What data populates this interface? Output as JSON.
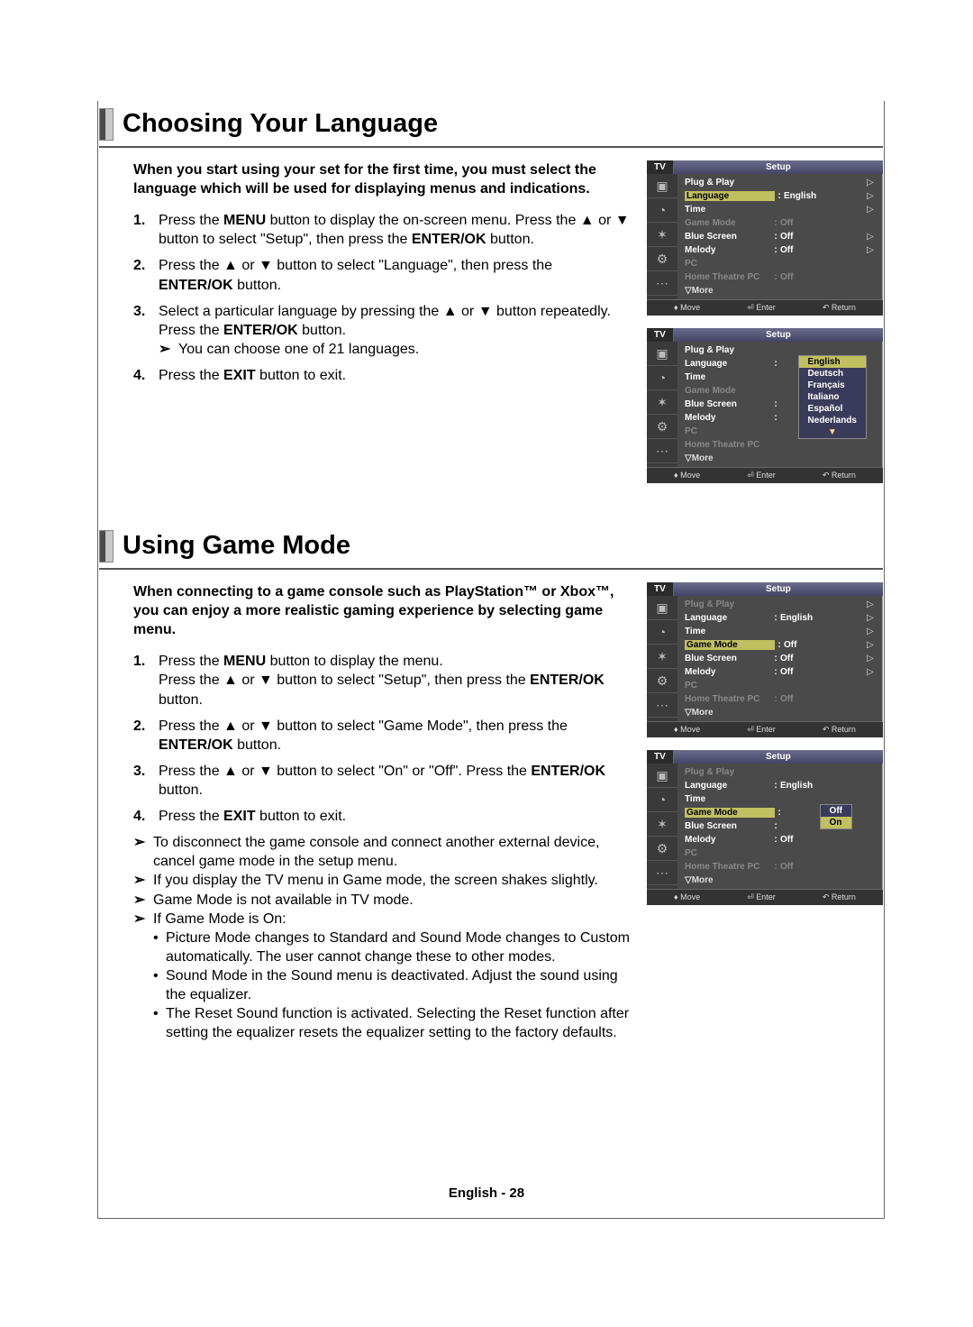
{
  "section1": {
    "title": "Choosing Your Language",
    "intro": "When you start using your set for the first time, you must select the language which will be used for displaying menus and indications.",
    "steps": [
      {
        "num": "1.",
        "html": "Press the <b>MENU</b> button to display the on-screen menu. Press the ▲ or ▼ button to select \"Setup\", then press the <b>ENTER/OK</b> button."
      },
      {
        "num": "2.",
        "html": "Press the ▲ or ▼ button to select \"Language\", then press the <b>ENTER/OK</b> button."
      },
      {
        "num": "3.",
        "html": "Select a particular language by pressing the ▲ or ▼ button repeatedly.<br>Press the <b>ENTER/OK</b> button.",
        "arrows": [
          "You can choose one of 21 languages."
        ]
      },
      {
        "num": "4.",
        "html": "Press the <b>EXIT</b> button to exit."
      }
    ]
  },
  "section2": {
    "title": "Using Game Mode",
    "intro": "When connecting to a game console such as PlayStation™ or Xbox™, you can enjoy a more realistic gaming experience by selecting game menu.",
    "steps": [
      {
        "num": "1.",
        "html": "Press the <b>MENU</b> button to display the menu.<br>Press the ▲ or ▼ button to select \"Setup\", then press the <b>ENTER/OK</b> button."
      },
      {
        "num": "2.",
        "html": "Press the ▲ or ▼ button to select \"Game Mode\", then press the <b>ENTER/OK</b> button."
      },
      {
        "num": "3.",
        "html": "Press the ▲ or ▼ button to select \"On\" or \"Off\". Press the <b>ENTER/OK</b> button."
      },
      {
        "num": "4.",
        "html": "Press the <b>EXIT</b> button to exit."
      }
    ],
    "arrows": [
      "To disconnect the game console and connect another external device, cancel game mode in the setup menu.",
      "If you display the TV menu in Game mode, the screen shakes slightly.",
      "Game Mode is not available in TV mode.",
      "If Game Mode is On:"
    ],
    "bullets": [
      "Picture Mode changes to Standard and Sound Mode changes to Custom automatically. The user cannot change these to other modes.",
      "Sound Mode in the Sound menu is deactivated. Adjust the sound using the equalizer.",
      "The Reset Sound function is activated. Selecting the Reset function after setting the equalizer resets the equalizer setting to the factory defaults."
    ]
  },
  "osd_common": {
    "tv": "TV",
    "setup": "Setup",
    "footer": {
      "move": "Move",
      "enter": "Enter",
      "return": "Return"
    },
    "tabs": [
      "▣",
      "◔",
      "✶",
      "⚙",
      "⋯"
    ]
  },
  "osd1": {
    "rows": [
      {
        "lbl": "Plug & Play",
        "val": "",
        "tri": "▷"
      },
      {
        "lbl": "Language",
        "val": "English",
        "sep": ":",
        "tri": "▷",
        "selected": true
      },
      {
        "lbl": "Time",
        "val": "",
        "tri": "▷"
      },
      {
        "lbl": "Game Mode",
        "val": "Off",
        "sep": ":",
        "dim": true
      },
      {
        "lbl": "Blue Screen",
        "val": "Off",
        "sep": ":",
        "tri": "▷"
      },
      {
        "lbl": "Melody",
        "val": "Off",
        "sep": ":",
        "tri": "▷"
      },
      {
        "lbl": "PC",
        "val": "",
        "dim": true
      },
      {
        "lbl": "Home Theatre PC",
        "val": "Off",
        "sep": ":",
        "dim": true
      },
      {
        "lbl": "▽More",
        "val": "",
        "more": true
      }
    ]
  },
  "osd2": {
    "rows": [
      {
        "lbl": "Plug & Play",
        "val": ""
      },
      {
        "lbl": "Language",
        "val": "",
        "sep": ":"
      },
      {
        "lbl": "Time",
        "val": ""
      },
      {
        "lbl": "Game Mode",
        "val": "",
        "dim": true
      },
      {
        "lbl": "Blue Screen",
        "val": "",
        "sep": ":"
      },
      {
        "lbl": "Melody",
        "val": "",
        "sep": ":"
      },
      {
        "lbl": "PC",
        "val": "",
        "dim": true
      },
      {
        "lbl": "Home Theatre PC",
        "val": "",
        "dim": true
      },
      {
        "lbl": "▽More",
        "val": "",
        "more": true
      }
    ],
    "langlist": [
      "English",
      "Deutsch",
      "Français",
      "Italiano",
      "Español",
      "Nederlands"
    ]
  },
  "osd3": {
    "rows": [
      {
        "lbl": "Plug & Play",
        "val": "",
        "dim": true,
        "tri": "▷"
      },
      {
        "lbl": "Language",
        "val": "English",
        "sep": ":",
        "tri": "▷"
      },
      {
        "lbl": "Time",
        "val": "",
        "tri": "▷"
      },
      {
        "lbl": "Game Mode",
        "val": "Off",
        "sep": ":",
        "tri": "▷",
        "selected": true
      },
      {
        "lbl": "Blue Screen",
        "val": "Off",
        "sep": ":",
        "tri": "▷"
      },
      {
        "lbl": "Melody",
        "val": "Off",
        "sep": ":",
        "tri": "▷"
      },
      {
        "lbl": "PC",
        "val": "",
        "dim": true
      },
      {
        "lbl": "Home Theatre PC",
        "val": "Off",
        "sep": ":",
        "dim": true
      },
      {
        "lbl": "▽More",
        "val": "",
        "more": true
      }
    ]
  },
  "osd4": {
    "rows": [
      {
        "lbl": "Plug & Play",
        "val": "",
        "dim": true
      },
      {
        "lbl": "Language",
        "val": "English",
        "sep": ":"
      },
      {
        "lbl": "Time",
        "val": ""
      },
      {
        "lbl": "Game Mode",
        "val": "",
        "sep": ":",
        "selected": true
      },
      {
        "lbl": "Blue Screen",
        "val": "",
        "sep": ":"
      },
      {
        "lbl": "Melody",
        "val": "Off",
        "sep": ":"
      },
      {
        "lbl": "PC",
        "val": "",
        "dim": true
      },
      {
        "lbl": "Home Theatre PC",
        "val": "Off",
        "sep": ":",
        "dim": true
      },
      {
        "lbl": "▽More",
        "val": "",
        "more": true
      }
    ],
    "options": [
      "Off",
      "On"
    ]
  },
  "page_footer": "English - 28"
}
